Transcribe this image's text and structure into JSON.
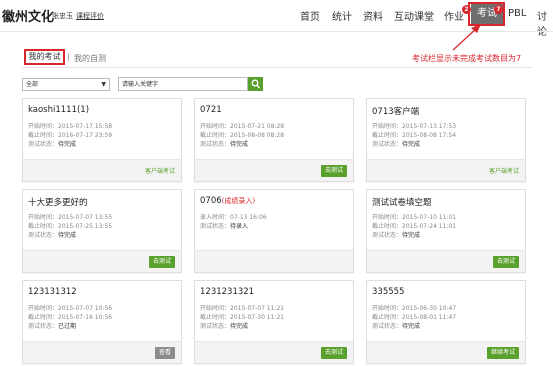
{
  "header": {
    "brand": "徽州文化",
    "user": "张忠玉",
    "course_eval": "课程评价",
    "nav": {
      "home": "首页",
      "stats": "统计",
      "resources": "资料",
      "interactive": "互动课堂",
      "homework": "作业",
      "exam": "考试",
      "pbl": "PBL",
      "discuss": "讨论"
    },
    "homework_badge": "2",
    "exam_badge": "7"
  },
  "annotation": {
    "text": "考试栏显示未完成考试数目为7",
    "color": "#d9262c"
  },
  "tabs": {
    "my_exams": "我的考试",
    "separator": "|",
    "my_self_tests": "我的自测"
  },
  "filter": {
    "select_value": "全部",
    "search_placeholder": "请输入关键字"
  },
  "labels": {
    "start": "开始时间：",
    "end": "截止时间：",
    "status": "测试状态：",
    "entry": "录入时间："
  },
  "cards": [
    {
      "title": "kaoshi1111(1)",
      "start": "2015-07-17 15:58",
      "end": "2016-07-17 23:59",
      "status": "待完成",
      "action": "客户端考试"
    },
    {
      "title": "0721",
      "start": "2015-07-21 08:28",
      "end": "2015-08-08 08:28",
      "status": "待完成",
      "action": "去测试"
    },
    {
      "title": "0713客户端",
      "start": "2015-07-13 17:53",
      "end": "2015-08-08 17:54",
      "status": "待完成",
      "action": "客户端考试"
    },
    {
      "title": "十大更多更好的",
      "start": "2015-07-07 13:55",
      "end": "2015-07-25 13:55",
      "status": "待完成",
      "action": "去测试"
    },
    {
      "title": "0706",
      "tag": "(成绩录入)",
      "entry": "07-13 16:06",
      "status": "待录入"
    },
    {
      "title": "测试试卷填空题",
      "start": "2015-07-10 11:01",
      "end": "2015-07-24 11:01",
      "status": "待完成",
      "action": "去测试"
    },
    {
      "title": "123131312",
      "start": "2015-07-07 10:56",
      "end": "2015-07-16 10:56",
      "status": "已过期",
      "action": "查看"
    },
    {
      "title": "1231231321",
      "start": "2015-07-07 11:21",
      "end": "2015-07-30 11:21",
      "status": "待完成",
      "action": "去测试"
    },
    {
      "title": "335555",
      "start": "2015-06-30 10:47",
      "end": "2015-08-01 11:47",
      "status": "待完成",
      "action": "继续考试"
    }
  ],
  "colors": {
    "accent_green": "#5aa02c",
    "badge_red": "#d9262c",
    "active_tab_bg": "#6e6e6e"
  }
}
